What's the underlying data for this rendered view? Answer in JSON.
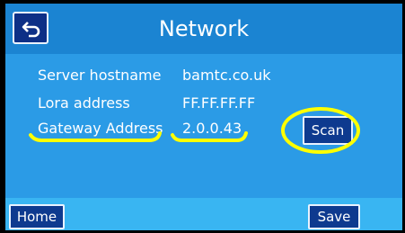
{
  "header": {
    "title": "Network",
    "back_icon": "back-arrow-icon"
  },
  "fields": [
    {
      "label": "Server hostname",
      "value": "bamtc.co.uk"
    },
    {
      "label": "Lora address",
      "value": "FF.FF.FF.FF"
    },
    {
      "label": "Gateway Address",
      "value": "2.0.0.43"
    }
  ],
  "buttons": {
    "scan": "Scan",
    "home": "Home",
    "save": "Save"
  },
  "colors": {
    "screen_bg": "#2b9be6",
    "title_bar": "#1b84d2",
    "button_bg": "#0e3a8f",
    "annotation": "#ffff00"
  }
}
